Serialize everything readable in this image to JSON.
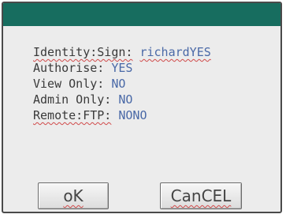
{
  "dialog": {
    "fields": [
      {
        "label": "Identity:Sign:",
        "value": "richardYES"
      },
      {
        "label": "Authorise:",
        "value": "YES"
      },
      {
        "label": "View Only:",
        "value": "NO"
      },
      {
        "label": "Admin Only:",
        "value": "NO"
      },
      {
        "label": "Remote:FTP:",
        "value": "NONO"
      }
    ],
    "ok_label": "oK",
    "cancel_label": "CanCEL"
  },
  "colors": {
    "titlebar": "#176d5f",
    "background": "#ececec",
    "value_text": "#4a69a7",
    "spellcheck_underline": "#d04a4a"
  }
}
